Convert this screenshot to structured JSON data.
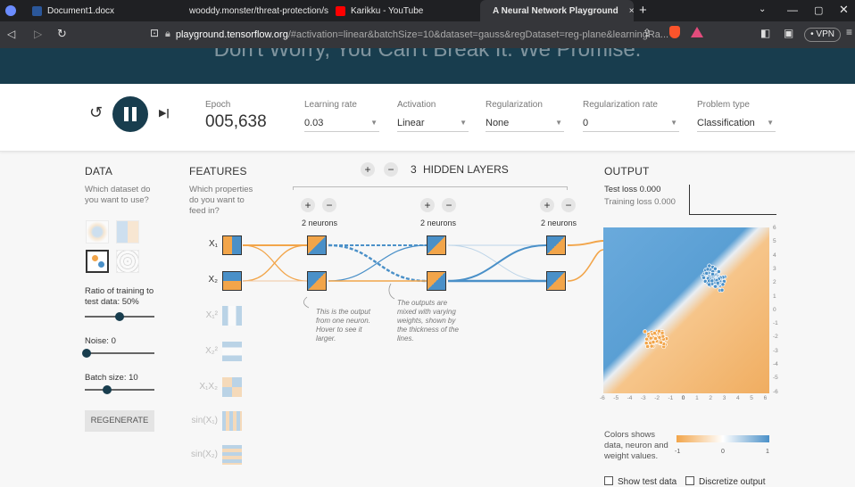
{
  "browser": {
    "tabs": [
      {
        "label": "Document1.docx",
        "color": "#2b579a"
      },
      {
        "label": "wooddy.monster/threat-protection/sn",
        "color": "#c0392b"
      },
      {
        "label": "Karikku - YouTube",
        "color": "#ff0000"
      },
      {
        "label": "A Neural Network Playground",
        "color": "#ffffff"
      }
    ],
    "url_host": "playground.tensorflow.org",
    "url_rest": "/#activation=linear&batchSize=10&dataset=gauss&regDataset=reg-plane&learningRa...",
    "vpn": "• VPN"
  },
  "hero": {
    "text": "Don't Worry, You Can't Break It. We Promise."
  },
  "controls": {
    "epoch_label": "Epoch",
    "epoch_value": "005,638",
    "learning_rate_label": "Learning rate",
    "learning_rate": "0.03",
    "activation_label": "Activation",
    "activation": "Linear",
    "regularization_label": "Regularization",
    "regularization": "None",
    "regularization_rate_label": "Regularization rate",
    "regularization_rate": "0",
    "problem_type_label": "Problem type",
    "problem_type": "Classification"
  },
  "data_panel": {
    "title": "DATA",
    "subtitle": "Which dataset do you want to use?",
    "ratio_label": "Ratio of training to test data:  50%",
    "ratio_value": 0.5,
    "noise_label": "Noise:  0",
    "noise_value": 0,
    "batch_label": "Batch size:  10",
    "batch_value": 0.3,
    "regenerate": "REGENERATE"
  },
  "features_panel": {
    "title": "FEATURES",
    "subtitle": "Which properties do you want to feed in?",
    "features": [
      {
        "label": "X₁",
        "active": true
      },
      {
        "label": "X₂",
        "active": true
      },
      {
        "label": "X₁²",
        "active": false
      },
      {
        "label": "X₂²",
        "active": false
      },
      {
        "label": "X₁X₂",
        "active": false
      },
      {
        "label": "sin(X₁)",
        "active": false
      },
      {
        "label": "sin(X₂)",
        "active": false
      }
    ]
  },
  "network": {
    "plus": "+",
    "minus": "−",
    "hidden_layers_count": "3",
    "hidden_layers_label": "HIDDEN LAYERS",
    "layers": [
      {
        "neurons_label": "2 neurons"
      },
      {
        "neurons_label": "2 neurons"
      },
      {
        "neurons_label": "2 neurons"
      }
    ],
    "note1": "This is the output from one neuron. Hover to see it larger.",
    "note2": "The outputs are mixed with varying weights, shown by the thickness of the lines."
  },
  "output_panel": {
    "title": "OUTPUT",
    "test_loss": "Test loss 0.000",
    "training_loss": "Training loss 0.000",
    "y_ticks": [
      "6",
      "5",
      "4",
      "3",
      "2",
      "1",
      "0",
      "-1",
      "-2",
      "-3",
      "-4",
      "-5",
      "-6"
    ],
    "x_ticks": [
      "-6",
      "-5",
      "-4",
      "-3",
      "-2",
      "-1",
      "0",
      "1",
      "2",
      "3",
      "4",
      "5",
      "6"
    ],
    "colors_label": "Colors shows data, neuron and weight values.",
    "scale_min": "-1",
    "scale_mid": "0",
    "scale_max": "1",
    "show_test_data": "Show test data",
    "discretize_output": "Discretize output",
    "color_positive": "#4a90c8",
    "color_negative": "#f2a54a"
  }
}
